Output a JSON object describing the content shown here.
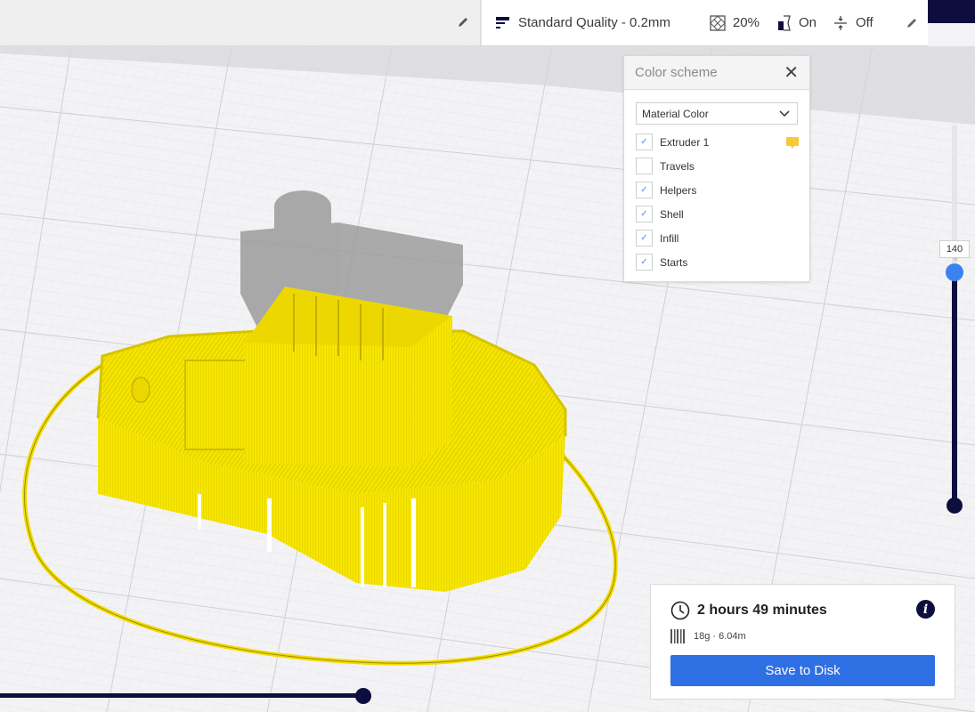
{
  "header": {
    "edit_icon": "pencil-icon"
  },
  "print_settings": {
    "profile_icon": "profile-bars-icon",
    "profile_label": "Standard Quality - 0.2mm",
    "infill_icon": "infill-pattern-icon",
    "infill_value": "20%",
    "support_icon": "support-icon",
    "support_value": "On",
    "adhesion_icon": "adhesion-icon",
    "adhesion_value": "Off",
    "edit_icon": "pencil-icon"
  },
  "color_scheme": {
    "title": "Color scheme",
    "close_icon": "close-icon",
    "selected_scheme": "Material Color",
    "options": [
      {
        "label": "Extruder 1",
        "checked": true,
        "swatch": "#f6c83a"
      },
      {
        "label": "Travels",
        "checked": false
      },
      {
        "label": "Helpers",
        "checked": true
      },
      {
        "label": "Shell",
        "checked": true
      },
      {
        "label": "Infill",
        "checked": true
      },
      {
        "label": "Starts",
        "checked": true
      }
    ],
    "check_glyph": "✓"
  },
  "layer_slider": {
    "current_layer": "140",
    "upper_fraction": 0.61,
    "lower_fraction": 0.0
  },
  "path_slider": {
    "fraction": 1.0
  },
  "output": {
    "time_icon": "clock-icon",
    "print_time": "2 hours 49 minutes",
    "info_icon": "info-icon",
    "info_glyph": "i",
    "material_icon": "filament-spool-icon",
    "material": "18g · 6.04m",
    "save_label": "Save to Disk"
  },
  "colors": {
    "accent": "#2f6fe4",
    "slider_handle": "#3a82ef",
    "dark": "#0e0e3e",
    "material": "#f6e000",
    "ghost_model": "#9a9a9a"
  }
}
